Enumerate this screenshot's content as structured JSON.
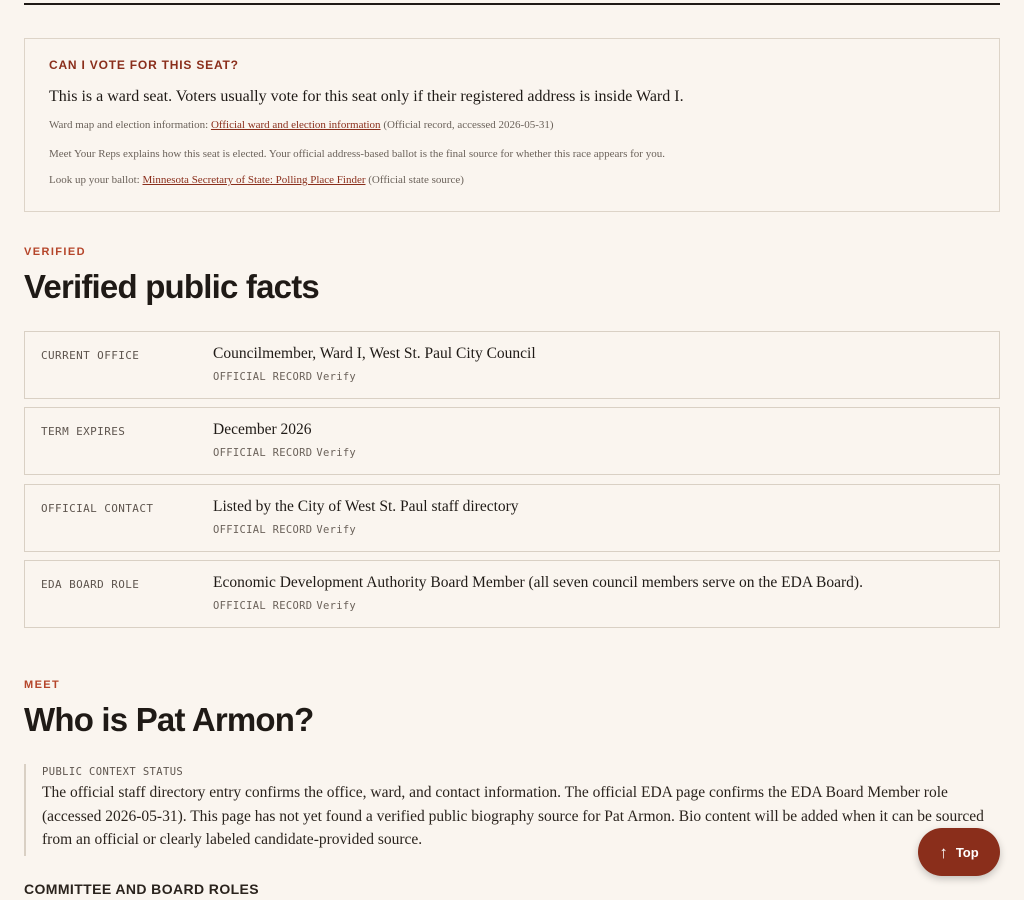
{
  "vote_card": {
    "eyebrow": "CAN I VOTE FOR THIS SEAT?",
    "lede": "This is a ward seat. Voters usually vote for this seat only if their registered address is inside Ward I.",
    "map_prefix": "Ward map and election information:",
    "map_link": "Official ward and election information",
    "map_suffix": "(Official record, accessed 2026-05-31)",
    "explain": "Meet Your Reps explains how this seat is elected. Your official address-based ballot is the final source for whether this race appears for you.",
    "ballot_prefix": "Look up your ballot:",
    "ballot_link": "Minnesota Secretary of State: Polling Place Finder",
    "ballot_suffix": "(Official state source)"
  },
  "verified": {
    "eyebrow": "VERIFIED",
    "title": "Verified public facts",
    "facts": [
      {
        "label": "CURRENT OFFICE",
        "value": "Councilmember, Ward I, West St. Paul City Council",
        "source": "OFFICIAL RECORD",
        "verify": "Verify"
      },
      {
        "label": "TERM EXPIRES",
        "value": "December 2026",
        "source": "OFFICIAL RECORD",
        "verify": "Verify"
      },
      {
        "label": "OFFICIAL CONTACT",
        "value": "Listed by the City of West St. Paul staff directory",
        "source": "OFFICIAL RECORD",
        "verify": "Verify"
      },
      {
        "label": "EDA BOARD ROLE",
        "value": "Economic Development Authority Board Member (all seven council members serve on the EDA Board).",
        "source": "OFFICIAL RECORD",
        "verify": "Verify"
      }
    ]
  },
  "meet": {
    "eyebrow": "MEET",
    "title": "Who is Pat Armon?",
    "context_label": "PUBLIC CONTEXT STATUS",
    "context_text": "The official staff directory entry confirms the office, ward, and contact information. The official EDA page confirms the EDA Board Member role (accessed 2026-05-31). This page has not yet found a verified public biography source for Pat Armon. Bio content will be added when it can be sourced from an official or clearly labeled candidate-provided source.",
    "roles_heading": "COMMITTEE AND BOARD ROLES"
  },
  "top_button": {
    "icon": "arrow-up-icon",
    "label": "Top"
  }
}
